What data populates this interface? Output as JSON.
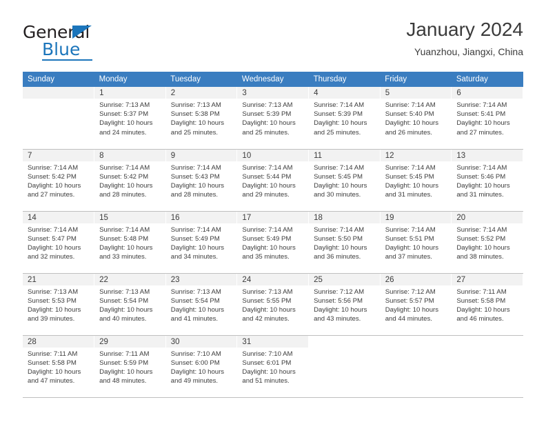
{
  "brand": {
    "name_dark": "General",
    "name_blue": "Blue",
    "flag_icon": "triangle-flag-icon",
    "accent_color": "#1b75bb"
  },
  "header": {
    "title": "January 2024",
    "subtitle": "Yuanzhou, Jiangxi, China"
  },
  "theme": {
    "header_row_bg": "#3a7dc0",
    "daynum_bg": "#f2f2f2",
    "text_color": "#3b3b3b",
    "grid_line": "#bfbfbf"
  },
  "weekdays": [
    "Sunday",
    "Monday",
    "Tuesday",
    "Wednesday",
    "Thursday",
    "Friday",
    "Saturday"
  ],
  "labels": {
    "sunrise_prefix": "Sunrise:",
    "sunset_prefix": "Sunset:",
    "daylight_prefix": "Daylight:"
  },
  "weeks": [
    [
      {
        "day": "",
        "sunrise": "",
        "sunset": "",
        "daylight": "",
        "blank": true
      },
      {
        "day": "1",
        "sunrise": "Sunrise: 7:13 AM",
        "sunset": "Sunset: 5:37 PM",
        "daylight": "Daylight: 10 hours and 24 minutes."
      },
      {
        "day": "2",
        "sunrise": "Sunrise: 7:13 AM",
        "sunset": "Sunset: 5:38 PM",
        "daylight": "Daylight: 10 hours and 25 minutes."
      },
      {
        "day": "3",
        "sunrise": "Sunrise: 7:13 AM",
        "sunset": "Sunset: 5:39 PM",
        "daylight": "Daylight: 10 hours and 25 minutes."
      },
      {
        "day": "4",
        "sunrise": "Sunrise: 7:14 AM",
        "sunset": "Sunset: 5:39 PM",
        "daylight": "Daylight: 10 hours and 25 minutes."
      },
      {
        "day": "5",
        "sunrise": "Sunrise: 7:14 AM",
        "sunset": "Sunset: 5:40 PM",
        "daylight": "Daylight: 10 hours and 26 minutes."
      },
      {
        "day": "6",
        "sunrise": "Sunrise: 7:14 AM",
        "sunset": "Sunset: 5:41 PM",
        "daylight": "Daylight: 10 hours and 27 minutes."
      }
    ],
    [
      {
        "day": "7",
        "sunrise": "Sunrise: 7:14 AM",
        "sunset": "Sunset: 5:42 PM",
        "daylight": "Daylight: 10 hours and 27 minutes."
      },
      {
        "day": "8",
        "sunrise": "Sunrise: 7:14 AM",
        "sunset": "Sunset: 5:42 PM",
        "daylight": "Daylight: 10 hours and 28 minutes."
      },
      {
        "day": "9",
        "sunrise": "Sunrise: 7:14 AM",
        "sunset": "Sunset: 5:43 PM",
        "daylight": "Daylight: 10 hours and 28 minutes."
      },
      {
        "day": "10",
        "sunrise": "Sunrise: 7:14 AM",
        "sunset": "Sunset: 5:44 PM",
        "daylight": "Daylight: 10 hours and 29 minutes."
      },
      {
        "day": "11",
        "sunrise": "Sunrise: 7:14 AM",
        "sunset": "Sunset: 5:45 PM",
        "daylight": "Daylight: 10 hours and 30 minutes."
      },
      {
        "day": "12",
        "sunrise": "Sunrise: 7:14 AM",
        "sunset": "Sunset: 5:45 PM",
        "daylight": "Daylight: 10 hours and 31 minutes."
      },
      {
        "day": "13",
        "sunrise": "Sunrise: 7:14 AM",
        "sunset": "Sunset: 5:46 PM",
        "daylight": "Daylight: 10 hours and 31 minutes."
      }
    ],
    [
      {
        "day": "14",
        "sunrise": "Sunrise: 7:14 AM",
        "sunset": "Sunset: 5:47 PM",
        "daylight": "Daylight: 10 hours and 32 minutes."
      },
      {
        "day": "15",
        "sunrise": "Sunrise: 7:14 AM",
        "sunset": "Sunset: 5:48 PM",
        "daylight": "Daylight: 10 hours and 33 minutes."
      },
      {
        "day": "16",
        "sunrise": "Sunrise: 7:14 AM",
        "sunset": "Sunset: 5:49 PM",
        "daylight": "Daylight: 10 hours and 34 minutes."
      },
      {
        "day": "17",
        "sunrise": "Sunrise: 7:14 AM",
        "sunset": "Sunset: 5:49 PM",
        "daylight": "Daylight: 10 hours and 35 minutes."
      },
      {
        "day": "18",
        "sunrise": "Sunrise: 7:14 AM",
        "sunset": "Sunset: 5:50 PM",
        "daylight": "Daylight: 10 hours and 36 minutes."
      },
      {
        "day": "19",
        "sunrise": "Sunrise: 7:14 AM",
        "sunset": "Sunset: 5:51 PM",
        "daylight": "Daylight: 10 hours and 37 minutes."
      },
      {
        "day": "20",
        "sunrise": "Sunrise: 7:14 AM",
        "sunset": "Sunset: 5:52 PM",
        "daylight": "Daylight: 10 hours and 38 minutes."
      }
    ],
    [
      {
        "day": "21",
        "sunrise": "Sunrise: 7:13 AM",
        "sunset": "Sunset: 5:53 PM",
        "daylight": "Daylight: 10 hours and 39 minutes."
      },
      {
        "day": "22",
        "sunrise": "Sunrise: 7:13 AM",
        "sunset": "Sunset: 5:54 PM",
        "daylight": "Daylight: 10 hours and 40 minutes."
      },
      {
        "day": "23",
        "sunrise": "Sunrise: 7:13 AM",
        "sunset": "Sunset: 5:54 PM",
        "daylight": "Daylight: 10 hours and 41 minutes."
      },
      {
        "day": "24",
        "sunrise": "Sunrise: 7:13 AM",
        "sunset": "Sunset: 5:55 PM",
        "daylight": "Daylight: 10 hours and 42 minutes."
      },
      {
        "day": "25",
        "sunrise": "Sunrise: 7:12 AM",
        "sunset": "Sunset: 5:56 PM",
        "daylight": "Daylight: 10 hours and 43 minutes."
      },
      {
        "day": "26",
        "sunrise": "Sunrise: 7:12 AM",
        "sunset": "Sunset: 5:57 PM",
        "daylight": "Daylight: 10 hours and 44 minutes."
      },
      {
        "day": "27",
        "sunrise": "Sunrise: 7:11 AM",
        "sunset": "Sunset: 5:58 PM",
        "daylight": "Daylight: 10 hours and 46 minutes."
      }
    ],
    [
      {
        "day": "28",
        "sunrise": "Sunrise: 7:11 AM",
        "sunset": "Sunset: 5:58 PM",
        "daylight": "Daylight: 10 hours and 47 minutes."
      },
      {
        "day": "29",
        "sunrise": "Sunrise: 7:11 AM",
        "sunset": "Sunset: 5:59 PM",
        "daylight": "Daylight: 10 hours and 48 minutes."
      },
      {
        "day": "30",
        "sunrise": "Sunrise: 7:10 AM",
        "sunset": "Sunset: 6:00 PM",
        "daylight": "Daylight: 10 hours and 49 minutes."
      },
      {
        "day": "31",
        "sunrise": "Sunrise: 7:10 AM",
        "sunset": "Sunset: 6:01 PM",
        "daylight": "Daylight: 10 hours and 51 minutes."
      },
      {
        "day": "",
        "sunrise": "",
        "sunset": "",
        "daylight": "",
        "empty": true
      },
      {
        "day": "",
        "sunrise": "",
        "sunset": "",
        "daylight": "",
        "empty": true
      },
      {
        "day": "",
        "sunrise": "",
        "sunset": "",
        "daylight": "",
        "empty": true
      }
    ]
  ]
}
